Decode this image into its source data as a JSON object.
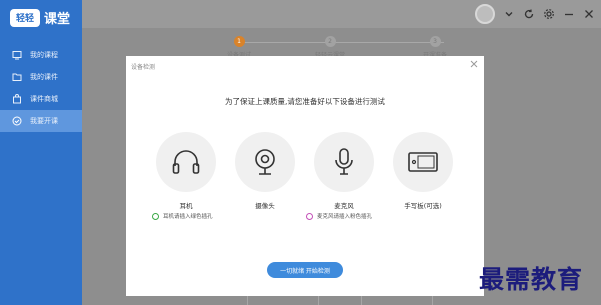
{
  "app": {
    "logo_badge": "轻轻",
    "logo_text": "课堂"
  },
  "sidebar": {
    "items": [
      {
        "label": "我的课程",
        "icon": "monitor-icon",
        "active": false
      },
      {
        "label": "我的课件",
        "icon": "folder-icon",
        "active": false
      },
      {
        "label": "课件商城",
        "icon": "shopping-bag-icon",
        "active": false
      },
      {
        "label": "我要开课",
        "icon": "check-circle-icon",
        "active": true
      }
    ]
  },
  "topbar": {
    "icons": [
      "avatar",
      "chevron-down-icon",
      "refresh-icon",
      "gear-icon",
      "minimize-icon",
      "close-icon"
    ]
  },
  "wizard": {
    "steps": [
      {
        "num": "1",
        "label": "设备测试"
      },
      {
        "num": "2",
        "label": "轻轻云课堂"
      },
      {
        "num": "3",
        "label": "开课准备"
      }
    ]
  },
  "modal": {
    "title": "设备检测",
    "heading": "为了保证上课质量,请您准备好以下设备进行测试",
    "devices": [
      {
        "name": "耳机",
        "icon": "headphones-icon"
      },
      {
        "name": "摄像头",
        "icon": "webcam-icon"
      },
      {
        "name": "麦克风",
        "icon": "microphone-icon"
      },
      {
        "name": "手写板(可选)",
        "icon": "tablet-icon"
      }
    ],
    "tips": [
      {
        "text": "耳机请插入绿色插孔",
        "color": "#3aa845"
      },
      {
        "text": "麦克风请插入粉色插孔",
        "color": "#c450b8"
      }
    ],
    "start_button": "一切就绪 开始检测"
  },
  "watermark": "最需教育",
  "colors": {
    "sidebar": "#2f72c9",
    "sidebar_active": "#5f97de",
    "button": "#3f8bdc",
    "wizard_active": "#d9832a"
  }
}
